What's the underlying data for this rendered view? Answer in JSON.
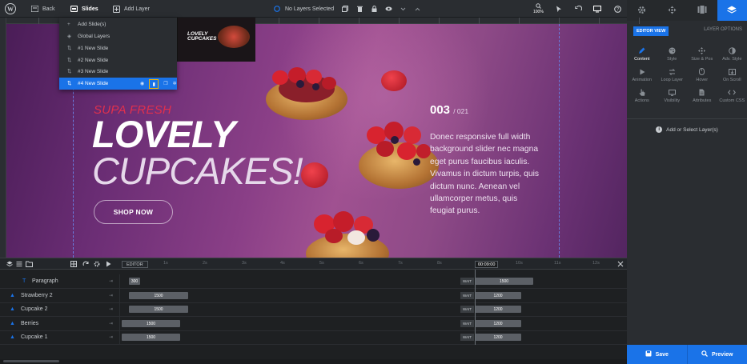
{
  "toolbar": {
    "back_label": "Back",
    "slides_label": "Slides",
    "add_layer_label": "Add Layer",
    "no_layers_label": "No Layers Selected",
    "zoom_label": "100%"
  },
  "right_panel": {
    "editor_view_label": "EDITOR VIEW",
    "layer_options_label": "LAYER OPTIONS",
    "options": [
      {
        "label": "Content",
        "icon": "pencil-icon"
      },
      {
        "label": "Style",
        "icon": "palette-icon"
      },
      {
        "label": "Size & Pos",
        "icon": "move-icon"
      },
      {
        "label": "Adv. Style",
        "icon": "contrast-icon"
      },
      {
        "label": "Animation",
        "icon": "play-icon"
      },
      {
        "label": "Loop Layer",
        "icon": "loop-icon"
      },
      {
        "label": "Hover",
        "icon": "mouse-icon"
      },
      {
        "label": "On Scroll",
        "icon": "scroll-icon"
      },
      {
        "label": "Actions",
        "icon": "pointer-icon"
      },
      {
        "label": "Visibility",
        "icon": "monitor-icon"
      },
      {
        "label": "Attributes",
        "icon": "file-icon"
      },
      {
        "label": "Custom CSS",
        "icon": "code-icon"
      }
    ],
    "add_select_label": "Add or Select Layer(s)",
    "save_label": "Save",
    "preview_label": "Preview"
  },
  "slides_menu": {
    "items": [
      {
        "label": "Add Slide(s)",
        "icon": "plus-icon"
      },
      {
        "label": "Global Layers",
        "icon": "layers-icon"
      },
      {
        "label": "#1 New Slide",
        "icon": "drag-icon"
      },
      {
        "label": "#2 New Slide",
        "icon": "drag-icon"
      },
      {
        "label": "#3 New Slide",
        "icon": "drag-icon"
      },
      {
        "label": "#4 New Slide",
        "icon": "drag-icon"
      }
    ],
    "thumb_title_1": "LOVELY",
    "thumb_title_2": "CUPCAKES"
  },
  "slide": {
    "tagline": "SUPA FRESH",
    "title_line1": "LOVELY",
    "title_line2": "CUPCAKES!",
    "button_label": "SHOP NOW",
    "counter": "003",
    "counter_total": "/ 021",
    "paragraph": "Donec responsive full width background slider nec magna eget purus faucibus iaculis. Vivamus in dictum turpis, quis dictum nunc. Aenean vel ullamcorper metus, quis feugiat purus."
  },
  "timeline": {
    "editor_label": "EDITOR",
    "current_time": "00:09:00",
    "ticks": [
      "1s",
      "2s",
      "3s",
      "4s",
      "5s",
      "6s",
      "7s",
      "8s",
      "9s",
      "10s",
      "11s",
      "12s"
    ],
    "wait_label": "WAIT",
    "layers": [
      {
        "name": "Paragraph",
        "icon": "text-icon",
        "in": "300",
        "out": "1500"
      },
      {
        "name": "Strawberry 2",
        "icon": "image-icon",
        "in": "1500",
        "out": "1200"
      },
      {
        "name": "Cupcake 2",
        "icon": "image-icon",
        "in": "1500",
        "out": "1200"
      },
      {
        "name": "Berries",
        "icon": "image-icon",
        "in": "1500",
        "out": "1200"
      },
      {
        "name": "Cupcake 1",
        "icon": "image-icon",
        "in": "1500",
        "out": "1200"
      }
    ]
  },
  "colors": {
    "accent": "#1a73e8",
    "tagline": "#e0304d",
    "highlight": "#f4b400"
  }
}
